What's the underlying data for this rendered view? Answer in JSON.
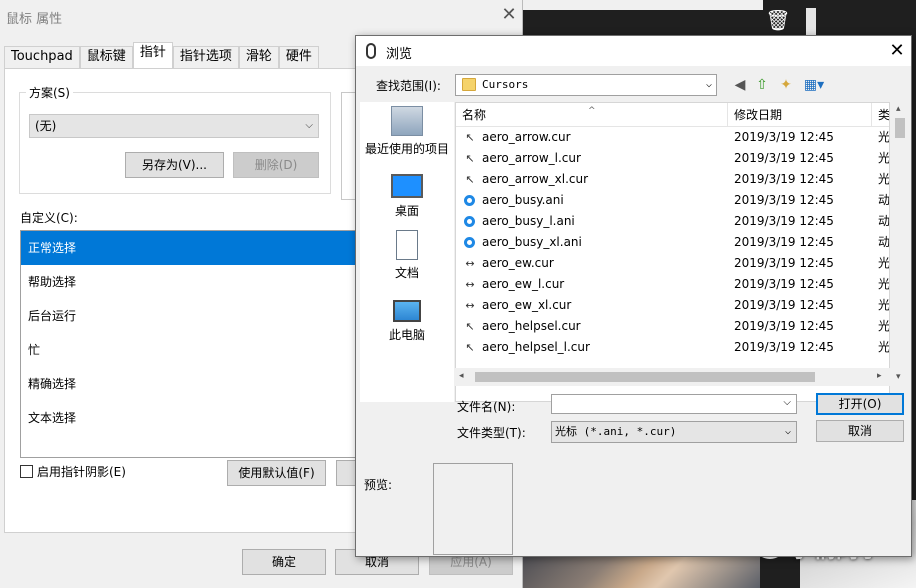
{
  "mouse_props": {
    "title": "鼠标 属性",
    "close": "✕",
    "tabs": [
      "Touchpad",
      "鼠标键",
      "指针",
      "指针选项",
      "滑轮",
      "硬件"
    ],
    "scheme_group_label": "方案(S)",
    "scheme_value": "(无)",
    "save_as_label": "另存为(V)...",
    "delete_label": "删除(D)",
    "custom_label": "自定义(C):",
    "cursor_items": [
      "正常选择",
      "帮助选择",
      "后台运行",
      "忙",
      "精确选择",
      "文本选择"
    ],
    "shadow_label": "启用指针阴影(E)",
    "use_default_label": "使用默认值(F)",
    "ok_label": "确定",
    "cancel_label": "取消",
    "apply_label": "应用(A)"
  },
  "browse": {
    "title": "浏览",
    "close": "✕",
    "lookin_label": "查找范围(I):",
    "lookin_value": "Cursors",
    "places": [
      "最近使用的项目",
      "桌面",
      "文档",
      "此电脑"
    ],
    "columns": [
      "名称",
      "修改日期",
      "类"
    ],
    "files": [
      {
        "name": "aero_arrow.cur",
        "date": "2019/3/19 12:45",
        "type": "光",
        "icon": "arrow-cursor-icon"
      },
      {
        "name": "aero_arrow_l.cur",
        "date": "2019/3/19 12:45",
        "type": "光",
        "icon": "arrow-cursor-icon"
      },
      {
        "name": "aero_arrow_xl.cur",
        "date": "2019/3/19 12:45",
        "type": "光",
        "icon": "arrow-cursor-icon"
      },
      {
        "name": "aero_busy.ani",
        "date": "2019/3/19 12:45",
        "type": "动",
        "icon": "busy-cursor-icon"
      },
      {
        "name": "aero_busy_l.ani",
        "date": "2019/3/19 12:45",
        "type": "动",
        "icon": "busy-cursor-icon"
      },
      {
        "name": "aero_busy_xl.ani",
        "date": "2019/3/19 12:45",
        "type": "动",
        "icon": "busy-cursor-icon"
      },
      {
        "name": "aero_ew.cur",
        "date": "2019/3/19 12:45",
        "type": "光",
        "icon": "resize-ew-cursor-icon"
      },
      {
        "name": "aero_ew_l.cur",
        "date": "2019/3/19 12:45",
        "type": "光",
        "icon": "resize-ew-cursor-icon"
      },
      {
        "name": "aero_ew_xl.cur",
        "date": "2019/3/19 12:45",
        "type": "光",
        "icon": "resize-ew-cursor-icon"
      },
      {
        "name": "aero_helpsel.cur",
        "date": "2019/3/19 12:45",
        "type": "光",
        "icon": "help-cursor-icon"
      },
      {
        "name": "aero_helpsel_l.cur",
        "date": "2019/3/19 12:45",
        "type": "光",
        "icon": "help-cursor-icon"
      }
    ],
    "filename_label": "文件名(N):",
    "filename_value": "",
    "filetype_label": "文件类型(T):",
    "filetype_value": "光标 (*.ani, *.cur)",
    "open_label": "打开(O)",
    "cancel_label": "取消",
    "preview_label": "预览:"
  },
  "watermark": "小桐同学"
}
